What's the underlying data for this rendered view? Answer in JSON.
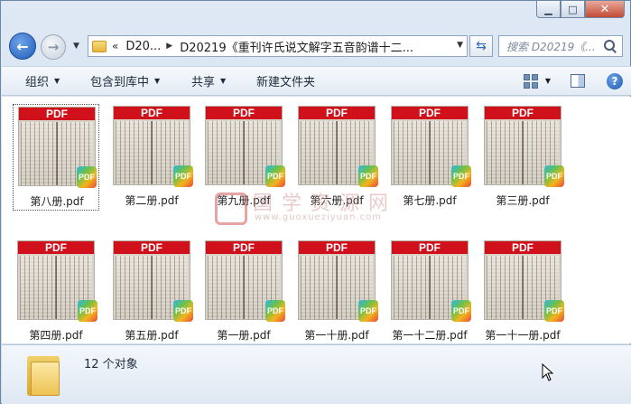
{
  "window": {
    "minimize_glyph": "▁",
    "maximize_glyph": "□",
    "close_glyph": "✕"
  },
  "nav": {
    "back_glyph": "←",
    "forward_glyph": "→",
    "dropdown_glyph": "▼",
    "overflow_glyph": "«",
    "breadcrumbs": [
      "D20...",
      "D20219《重刊许氏说文解字五音韵谱十二..."
    ],
    "crumb_separator": "▶",
    "refresh_glyph": "⇆",
    "search_placeholder": "搜索 D20219《..."
  },
  "toolbar": {
    "items": [
      {
        "label": "组织",
        "has_dropdown": true
      },
      {
        "label": "包含到库中",
        "has_dropdown": true
      },
      {
        "label": "共享",
        "has_dropdown": true
      },
      {
        "label": "新建文件夹",
        "has_dropdown": false
      }
    ],
    "caret_glyph": "▼",
    "help_glyph": "?"
  },
  "files": [
    {
      "name": "第八册.pdf",
      "band": "PDF",
      "badge": "PDF",
      "selected": true
    },
    {
      "name": "第二册.pdf",
      "band": "PDF",
      "badge": "PDF",
      "selected": false
    },
    {
      "name": "第九册.pdf",
      "band": "PDF",
      "badge": "PDF",
      "selected": false
    },
    {
      "name": "第六册.pdf",
      "band": "PDF",
      "badge": "PDF",
      "selected": false
    },
    {
      "name": "第七册.pdf",
      "band": "PDF",
      "badge": "PDF",
      "selected": false
    },
    {
      "name": "第三册.pdf",
      "band": "PDF",
      "badge": "PDF",
      "selected": false
    },
    {
      "name": "第四册.pdf",
      "band": "PDF",
      "badge": "PDF",
      "selected": false
    },
    {
      "name": "第五册.pdf",
      "band": "PDF",
      "badge": "PDF",
      "selected": false
    },
    {
      "name": "第一册.pdf",
      "band": "PDF",
      "badge": "PDF",
      "selected": false
    },
    {
      "name": "第一十册.pdf",
      "band": "PDF",
      "badge": "PDF",
      "selected": false
    },
    {
      "name": "第一十二册.pdf",
      "band": "PDF",
      "badge": "PDF",
      "selected": false
    },
    {
      "name": "第一十一册.pdf",
      "band": "PDF",
      "badge": "PDF",
      "selected": false
    }
  ],
  "watermark": {
    "title": "国学资源网",
    "url": "www.guoxueziyuan.com"
  },
  "status": {
    "count_text": "12 个对象"
  },
  "colors": {
    "pdf_band": "#d0101a",
    "accent": "#2f66b5"
  }
}
